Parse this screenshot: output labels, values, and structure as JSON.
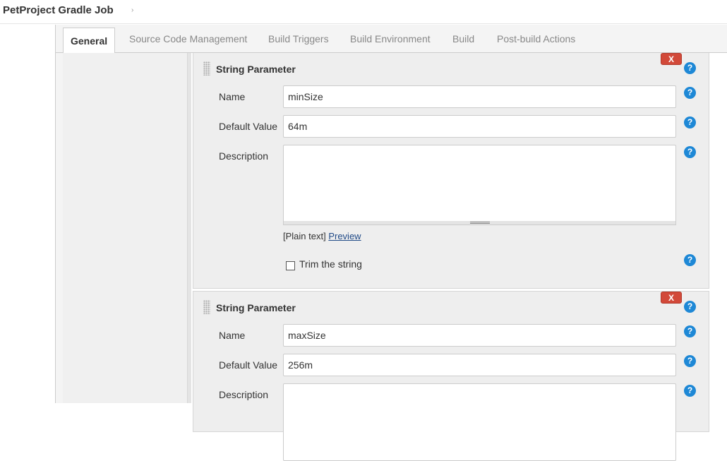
{
  "breadcrumb": {
    "job_title": "PetProject Gradle Job",
    "arrow": "›"
  },
  "tabs": [
    {
      "label": "General",
      "active": true
    },
    {
      "label": "Source Code Management",
      "active": false
    },
    {
      "label": "Build Triggers",
      "active": false
    },
    {
      "label": "Build Environment",
      "active": false
    },
    {
      "label": "Build",
      "active": false
    },
    {
      "label": "Post-build Actions",
      "active": false
    }
  ],
  "parameters": [
    {
      "title": "String Parameter",
      "delete_label": "X",
      "name_label": "Name",
      "name_value": "minSize",
      "default_label": "Default Value",
      "default_value": "64m",
      "description_label": "Description",
      "description_value": "",
      "format_text": "[Plain text]",
      "preview_link": "Preview",
      "trim_label": "Trim the string",
      "trim_checked": false
    },
    {
      "title": "String Parameter",
      "delete_label": "X",
      "name_label": "Name",
      "name_value": "maxSize",
      "default_label": "Default Value",
      "default_value": "256m",
      "description_label": "Description"
    }
  ],
  "help_icon_glyph": "?",
  "colors": {
    "delete_button": "#d24939",
    "help_icon": "#1e88d6",
    "link": "#204a87"
  }
}
